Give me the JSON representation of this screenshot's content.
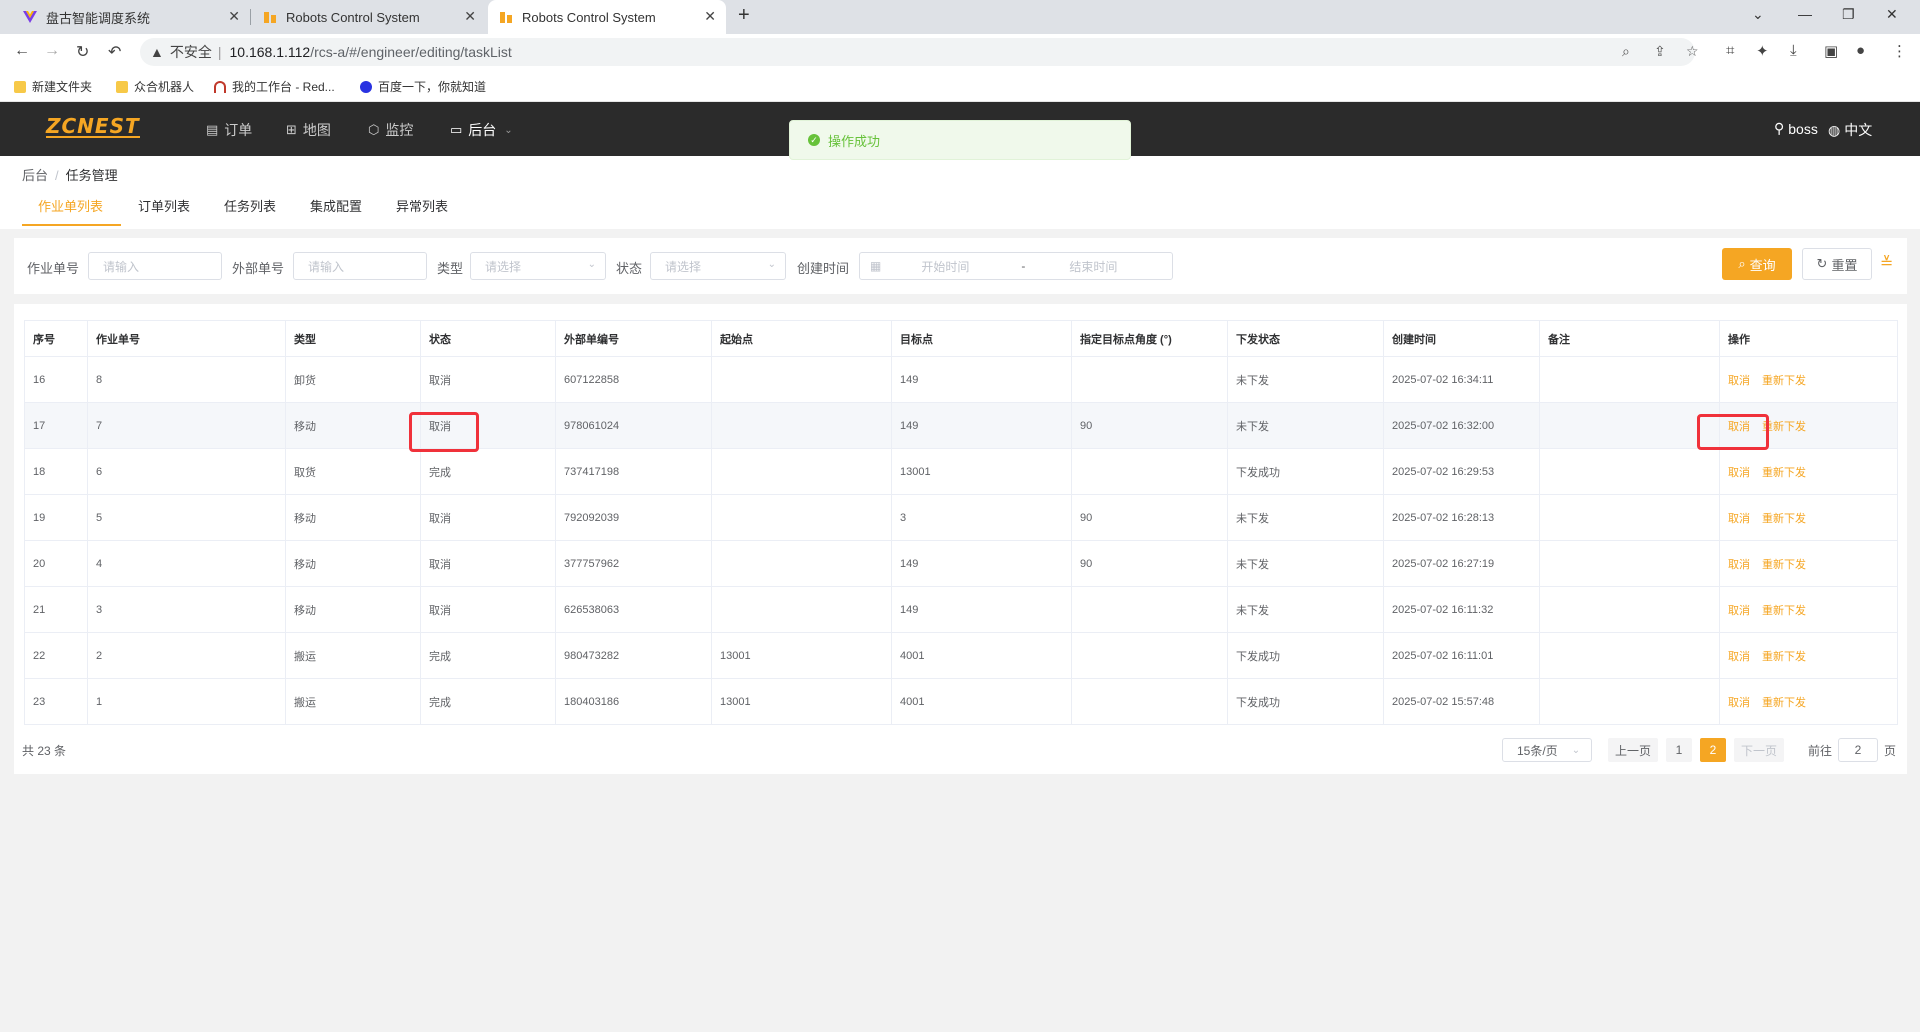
{
  "browser": {
    "tabs": [
      {
        "title": "盘古智能调度系统"
      },
      {
        "title": "Robots Control System"
      },
      {
        "title": "Robots Control System"
      }
    ],
    "insecure_label": "不安全",
    "url_host": "10.168.1.112",
    "url_path": "/rcs-a/#/engineer/editing/taskList",
    "bookmarks": [
      "新建文件夹",
      "众合机器人",
      "我的工作台 - Red...",
      "百度一下，你就知道"
    ]
  },
  "header": {
    "logo": "ZCNEST",
    "nav": [
      "订单",
      "地图",
      "监控",
      "后台"
    ],
    "user": "boss",
    "language": "中文"
  },
  "toast": {
    "message": "操作成功"
  },
  "breadcrumb": [
    "后台",
    "任务管理"
  ],
  "page_tabs": [
    "作业单列表",
    "订单列表",
    "任务列表",
    "集成配置",
    "异常列表"
  ],
  "filter": {
    "job_no_label": "作业单号",
    "job_no_placeholder": "请输入",
    "ext_no_label": "外部单号",
    "ext_no_placeholder": "请输入",
    "type_label": "类型",
    "type_placeholder": "请选择",
    "status_label": "状态",
    "status_placeholder": "请选择",
    "created_label": "创建时间",
    "start_placeholder": "开始时间",
    "range_sep": "-",
    "end_placeholder": "结束时间",
    "query_label": "查询",
    "reset_label": "重置"
  },
  "table": {
    "columns": [
      "序号",
      "作业单号",
      "类型",
      "状态",
      "外部单编号",
      "起始点",
      "目标点",
      "指定目标点角度 (°)",
      "下发状态",
      "创建时间",
      "备注",
      "操作"
    ],
    "rows": [
      [
        "16",
        "8",
        "卸货",
        "取消",
        "607122858",
        "",
        "149",
        "",
        "未下发",
        "2025-07-02 16:34:11",
        ""
      ],
      [
        "17",
        "7",
        "移动",
        "取消",
        "978061024",
        "",
        "149",
        "90",
        "未下发",
        "2025-07-02 16:32:00",
        ""
      ],
      [
        "18",
        "6",
        "取货",
        "完成",
        "737417198",
        "",
        "13001",
        "",
        "下发成功",
        "2025-07-02 16:29:53",
        ""
      ],
      [
        "19",
        "5",
        "移动",
        "取消",
        "792092039",
        "",
        "3",
        "90",
        "未下发",
        "2025-07-02 16:28:13",
        ""
      ],
      [
        "20",
        "4",
        "移动",
        "取消",
        "377757962",
        "",
        "149",
        "90",
        "未下发",
        "2025-07-02 16:27:19",
        ""
      ],
      [
        "21",
        "3",
        "移动",
        "取消",
        "626538063",
        "",
        "149",
        "",
        "未下发",
        "2025-07-02 16:11:32",
        ""
      ],
      [
        "22",
        "2",
        "搬运",
        "完成",
        "980473282",
        "13001",
        "4001",
        "",
        "下发成功",
        "2025-07-02 16:11:01",
        ""
      ],
      [
        "23",
        "1",
        "搬运",
        "完成",
        "180403186",
        "13001",
        "4001",
        "",
        "下发成功",
        "2025-07-02 15:57:48",
        ""
      ]
    ],
    "action_cancel": "取消",
    "action_resend": "重新下发"
  },
  "pagination": {
    "total": "共 23 条",
    "page_size": "15条/页",
    "prev": "上一页",
    "pages": [
      "1",
      "2"
    ],
    "next": "下一页",
    "goto_prefix": "前往",
    "goto_value": "2",
    "goto_suffix": "页"
  },
  "colors": {
    "accent": "#f5a623",
    "success": "#67c23a",
    "highlight": "#f0313a"
  }
}
